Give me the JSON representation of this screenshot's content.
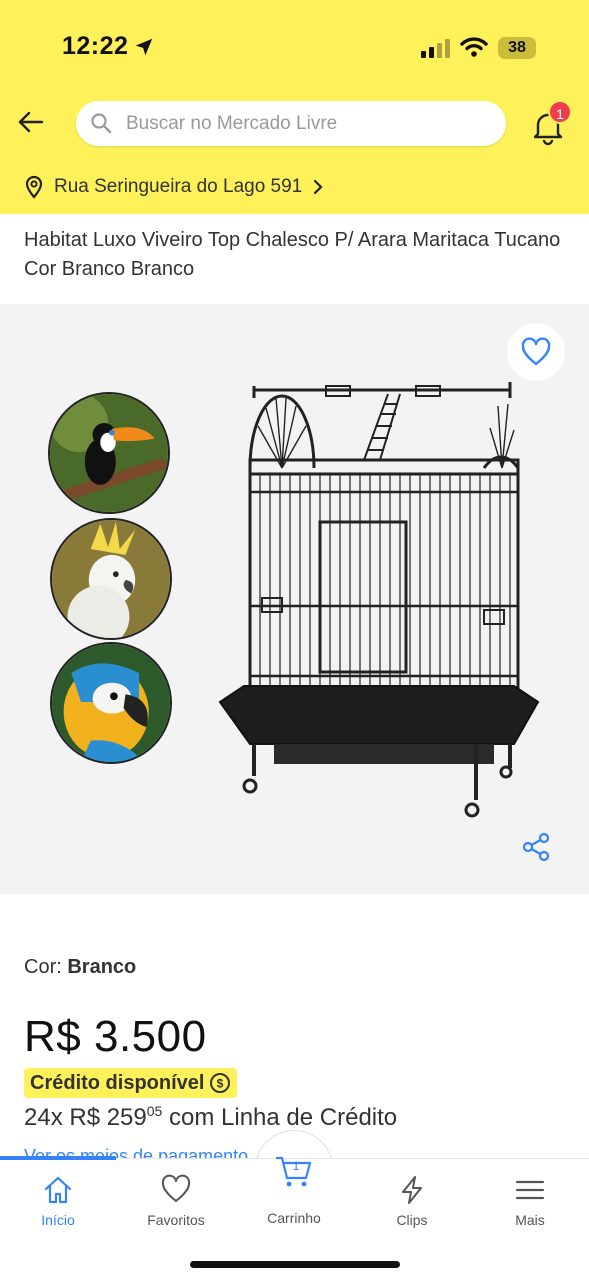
{
  "status_bar": {
    "time": "12:22",
    "battery": "38"
  },
  "search": {
    "placeholder": "Buscar no Mercado Livre"
  },
  "notifications": {
    "count": "1"
  },
  "address": {
    "text": "Rua Seringueira do Lago 591"
  },
  "product": {
    "title": "Habitat Luxo Viveiro Top Chalesco P/ Arara Maritaca Tucano Cor Branco Branco",
    "color_label": "Cor:",
    "color_value": "Branco",
    "price": "R$ 3.500",
    "credit_badge": "Crédito disponível",
    "installments_prefix": "24x R$ 259",
    "installments_cents": "05",
    "installments_suffix": " com Linha de Crédito",
    "payment_link": "Ver os meios de pagamento"
  },
  "bottom_nav": {
    "items": [
      {
        "label": "Início",
        "icon": "home-icon",
        "active": true
      },
      {
        "label": "Favoritos",
        "icon": "heart-icon"
      },
      {
        "label": "Carrinho",
        "icon": "cart-icon",
        "badge": "1"
      },
      {
        "label": "Clips",
        "icon": "lightning-icon"
      },
      {
        "label": "Mais",
        "icon": "menu-icon"
      }
    ]
  },
  "colors": {
    "header_bg": "#fff159",
    "accent": "#3483fa",
    "badge": "#f23d4f"
  }
}
